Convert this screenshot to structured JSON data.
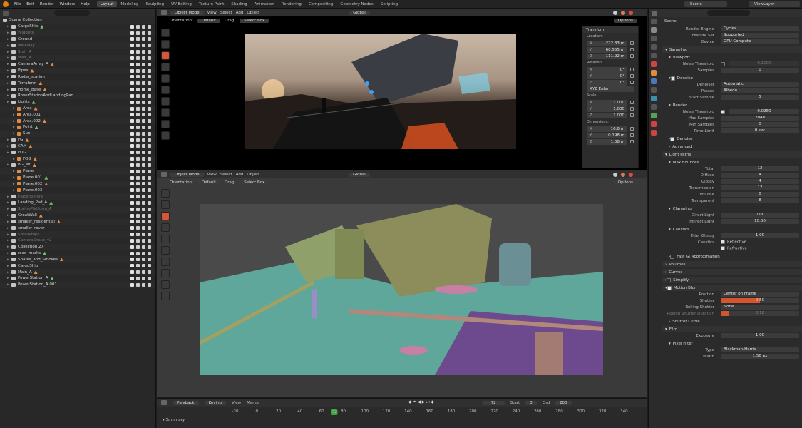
{
  "menu": [
    "File",
    "Edit",
    "Render",
    "Window",
    "Help"
  ],
  "workspaces": [
    "Layout",
    "Modeling",
    "Sculpting",
    "UV Editing",
    "Texture Paint",
    "Shading",
    "Animation",
    "Rendering",
    "Compositing",
    "Geometry Nodes",
    "Scripting"
  ],
  "scene_field": "Scene",
  "viewlayer_field": "ViewLayer",
  "outliner": {
    "root": "Scene Collection",
    "rows": [
      {
        "name": "CargoShip",
        "dim": false
      },
      {
        "name": "Widgets",
        "dim": true
      },
      {
        "name": "Ground",
        "dim": false
      },
      {
        "name": "walkway",
        "dim": true
      },
      {
        "name": "Stair_A",
        "dim": true
      },
      {
        "name": "stair_A",
        "dim": true
      },
      {
        "name": "CameraArray_A",
        "dim": false
      },
      {
        "name": "Pipes",
        "dim": false
      },
      {
        "name": "Radar_station",
        "dim": false
      },
      {
        "name": "Terraform",
        "dim": false
      },
      {
        "name": "Home_Base",
        "dim": false
      },
      {
        "name": "RoverStationAndLandingPad",
        "dim": false
      },
      {
        "name": "Lights",
        "dim": false
      },
      {
        "name": "Area",
        "dim": false
      },
      {
        "name": "Area.001",
        "dim": false
      },
      {
        "name": "Area.002",
        "dim": false
      },
      {
        "name": "Point",
        "dim": false
      },
      {
        "name": "Sun",
        "dim": false
      },
      {
        "name": "FG",
        "dim": false
      },
      {
        "name": "CAM",
        "dim": false
      },
      {
        "name": "FOG",
        "dim": false
      },
      {
        "name": "FOG",
        "dim": false
      },
      {
        "name": "BG_Mt",
        "dim": false
      },
      {
        "name": "Plane",
        "dim": false
      },
      {
        "name": "Plane.001",
        "dim": false
      },
      {
        "name": "Plane.002",
        "dim": false
      },
      {
        "name": "Plane.003",
        "dim": false
      },
      {
        "name": "Placeholders",
        "dim": true
      },
      {
        "name": "Landing_Pad_A",
        "dim": false
      },
      {
        "name": "SpringPlatform_A",
        "dim": true
      },
      {
        "name": "GreatWall",
        "dim": false
      },
      {
        "name": "smaller_residential",
        "dim": false
      },
      {
        "name": "smaller_rover",
        "dim": false
      },
      {
        "name": "SmallProps",
        "dim": true
      },
      {
        "name": "CameraShake_v2",
        "dim": true
      },
      {
        "name": "Collection 27",
        "dim": false
      },
      {
        "name": "road_marks",
        "dim": false
      },
      {
        "name": "Sparks_and_Smokes",
        "dim": false
      },
      {
        "name": "CargoShip",
        "dim": false
      },
      {
        "name": "Main_A",
        "dim": false
      },
      {
        "name": "PowerStation_A",
        "dim": false
      },
      {
        "name": "PowerStation_A.001",
        "dim": false
      }
    ]
  },
  "viewport_top": {
    "mode": "Object Mode",
    "menus": [
      "View",
      "Select",
      "Add",
      "Object"
    ],
    "orientation_label": "Orientation:",
    "orientation": "Default",
    "drag_label": "Drag:",
    "drag": "Select Box",
    "transform_space": "Global",
    "options": "Options"
  },
  "viewport_bottom": {
    "mode": "Object Mode",
    "menus": [
      "View",
      "Select",
      "Add",
      "Object"
    ],
    "orientation_label": "Orientation:",
    "orientation": "Default",
    "drag_label": "Drag:",
    "drag": "Select Box",
    "transform_space": "Global",
    "options": "Options"
  },
  "n_panel": {
    "title": "Transform",
    "location_label": "Location:",
    "location": [
      {
        "k": "X",
        "v": "-272.33 m"
      },
      {
        "k": "Y",
        "v": "60.555 m"
      },
      {
        "k": "Z",
        "v": "111.92 m"
      }
    ],
    "rotation_label": "Rotation:",
    "rotation": [
      {
        "k": "X",
        "v": "0°"
      },
      {
        "k": "Y",
        "v": "0°"
      },
      {
        "k": "Z",
        "v": "0°"
      }
    ],
    "rotation_mode": "XYZ Euler",
    "scale_label": "Scale:",
    "scale": [
      {
        "k": "X",
        "v": "1.000"
      },
      {
        "k": "Y",
        "v": "1.000"
      },
      {
        "k": "Z",
        "v": "1.000"
      }
    ],
    "dimensions_label": "Dimensions:",
    "dimensions": [
      {
        "k": "X",
        "v": "16.6 m"
      },
      {
        "k": "Y",
        "v": "0.198 m"
      },
      {
        "k": "Z",
        "v": "1.08 m"
      }
    ]
  },
  "timeline": {
    "menus": [
      "Playback",
      "Keying",
      "View",
      "Marker"
    ],
    "current_frame": "72",
    "start_label": "Start",
    "start": "0",
    "end_label": "End",
    "end": "200",
    "ruler": [
      "-20",
      "0",
      "20",
      "40",
      "60",
      "80",
      "100",
      "120",
      "140",
      "160",
      "180",
      "200",
      "220",
      "240",
      "260",
      "280",
      "300",
      "320",
      "340"
    ],
    "summary": "Summary"
  },
  "properties": {
    "context": "Scene",
    "render_engine_label": "Render Engine",
    "render_engine": "Cycles",
    "feature_set_label": "Feature Set",
    "feature_set": "Supported",
    "device_label": "Device",
    "device": "GPU Compute",
    "sampling": "Sampling",
    "viewport": "Viewport",
    "vp_noise_threshold_label": "Noise Threshold",
    "vp_noise_threshold": "0.1000",
    "vp_max_samples_label": "Samples",
    "vp_max_samples": "0",
    "denoise": "Denoise",
    "denoiser_label": "Denoiser",
    "denoiser": "Automatic",
    "passes_label": "Passes",
    "passes": "Albedo",
    "start_sample_label": "Start Sample",
    "start_sample": "5",
    "render": "Render",
    "noise_threshold_label": "Noise Threshold",
    "noise_threshold": "0.0250",
    "max_samples_label": "Max Samples",
    "max_samples": "2048",
    "min_samples_label": "Min Samples",
    "min_samples": "0",
    "time_limit_label": "Time Limit",
    "time_limit": "0 sec",
    "denoise2": "Denoise",
    "advanced": "Advanced",
    "light_paths": "Light Paths",
    "max_bounces": "Max Bounces",
    "bounces": [
      {
        "l": "Total",
        "v": "12"
      },
      {
        "l": "Diffuse",
        "v": "4"
      },
      {
        "l": "Glossy",
        "v": "4"
      },
      {
        "l": "Transmission",
        "v": "12"
      },
      {
        "l": "Volume",
        "v": "0"
      },
      {
        "l": "Transparent",
        "v": "8"
      }
    ],
    "clamping": "Clamping",
    "direct_light_label": "Direct Light",
    "direct_light": "0.00",
    "indirect_light_label": "Indirect Light",
    "indirect_light": "10.00",
    "caustics": "Caustics",
    "filter_glossy_label": "Filter Glossy",
    "filter_glossy": "1.00",
    "caustics_label": "Caustics",
    "reflective": "Reflective",
    "refractive": "Refractive",
    "fast_gi": "Fast GI Approximation",
    "volumes": "Volumes",
    "curves": "Curves",
    "simplify": "Simplify",
    "motion_blur": "Motion Blur",
    "position_label": "Position",
    "position": "Center on Frame",
    "shutter_label": "Shutter",
    "shutter": "0.50",
    "rolling_shutter_label": "Rolling Shutter",
    "rolling_shutter": "None",
    "rs_duration_label": "Rolling Shutter Duration",
    "rs_duration": "0.10",
    "shutter_curve": "Shutter Curve",
    "film": "Film",
    "exposure_label": "Exposure",
    "exposure": "1.00",
    "pixel_filter": "Pixel Filter",
    "type_label": "Type",
    "type": "Blackman-Harris",
    "width_label": "Width",
    "width": "1.50 px"
  }
}
